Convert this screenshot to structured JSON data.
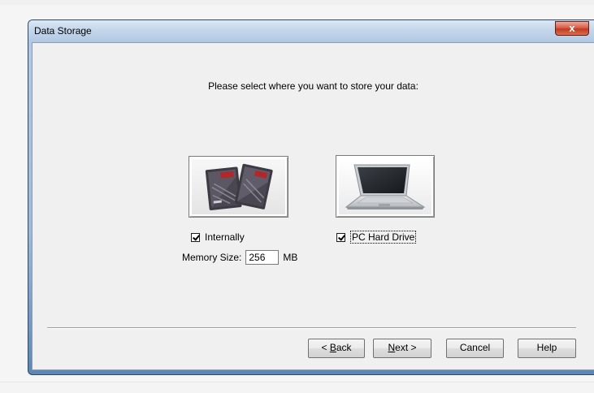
{
  "window": {
    "title": "Data Storage",
    "close_glyph": "x"
  },
  "prompt": "Please select where you want to store your data:",
  "options": {
    "internal": {
      "label": "Internally",
      "checked": true,
      "image_icon": "sd-card-icon"
    },
    "pc": {
      "label": "PC Hard Drive",
      "checked": true,
      "image_icon": "laptop-icon"
    }
  },
  "memory": {
    "label": "Memory Size:",
    "value": "256",
    "unit": "MB"
  },
  "buttons": {
    "back": {
      "prefix": "< ",
      "mnemonic": "B",
      "rest": "ack"
    },
    "next": {
      "mnemonic": "N",
      "rest": "ext",
      "suffix": " >"
    },
    "cancel": "Cancel",
    "help": "Help"
  },
  "colors": {
    "titlebar": "#c4d6eb",
    "close_button": "#c13b22",
    "dialog_background": "#f0f0f0"
  }
}
